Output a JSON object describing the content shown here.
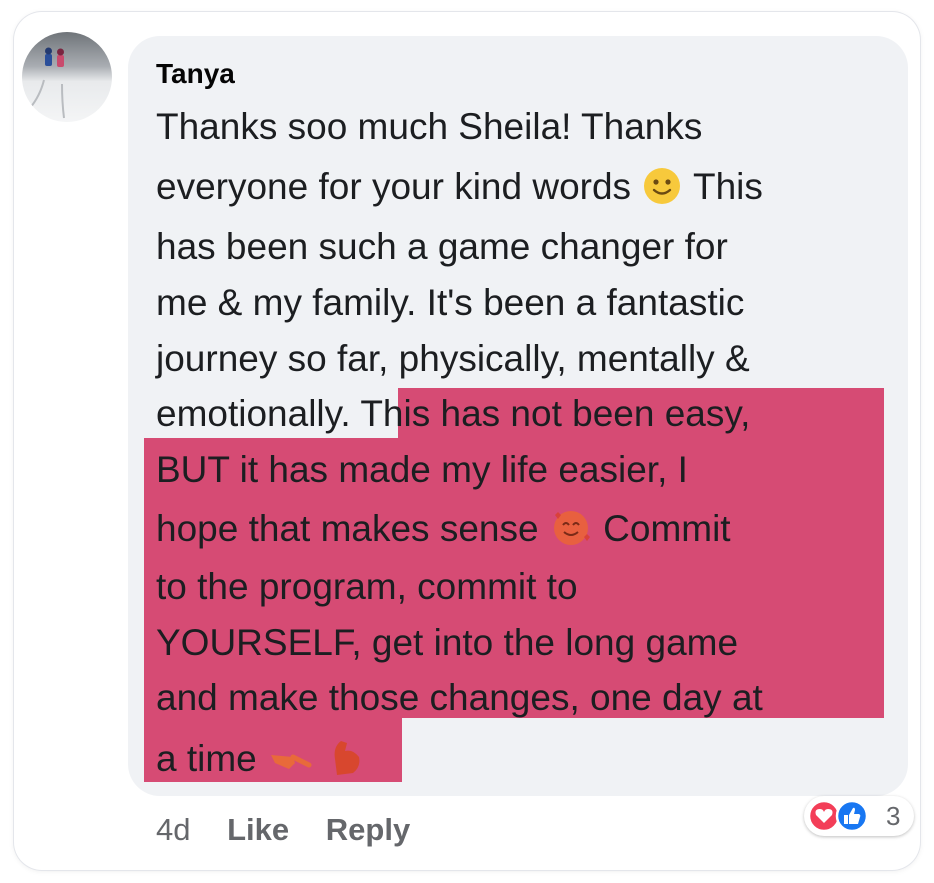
{
  "comment": {
    "author": "Tanya",
    "lines": {
      "l1": "Thanks soo much Sheila! Thanks",
      "l2a": "everyone for your kind words",
      "l2b": "This",
      "l3": "has been such a game changer for",
      "l4": "me & my family. It's been a fantastic",
      "l5": "journey so far, physically, mentally &",
      "l6a": "emotionally.",
      "l6b": "This has not been easy,",
      "l7": "BUT it has made my life easier, I",
      "l8a": "hope that makes sense",
      "l8b": "Commit",
      "l9": "to the program, commit to",
      "l10": "YOURSELF, get into the long game",
      "l11": "and make those changes, one day at",
      "l12": "a time"
    },
    "emojis": {
      "slight_smile": "slightly-smiling-face-icon",
      "hearts_face": "smiling-face-with-hearts-icon",
      "pointing": "pointing-hand-icon",
      "flex": "flexed-biceps-icon"
    },
    "highlight_color": "#d64b74"
  },
  "actions": {
    "time": "4d",
    "like_label": "Like",
    "reply_label": "Reply"
  },
  "reactions": {
    "count": "3",
    "types": [
      "love-reaction-icon",
      "like-reaction-icon"
    ]
  },
  "colors": {
    "bubble": "#f0f2f5",
    "like_blue": "#1877f2",
    "love_red": "#f33e58"
  }
}
